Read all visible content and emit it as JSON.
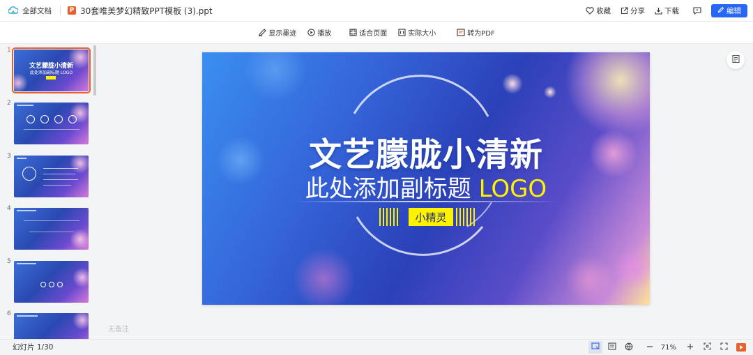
{
  "topbar": {
    "brand_label": "全部文档",
    "file_badge": "P",
    "filename": "30套唯美梦幻精致PPT模板 (3).ppt",
    "favorite_label": "收藏",
    "share_label": "分享",
    "download_label": "下载",
    "edit_label": "编辑"
  },
  "toolbar": {
    "show_ink_label": "显示墨迹",
    "play_label": "播放",
    "fit_page_label": "适合页面",
    "actual_size_label": "实际大小",
    "to_pdf_label": "转为PDF"
  },
  "sidebar": {
    "slides": [
      {
        "num": "1",
        "selected": true
      },
      {
        "num": "2"
      },
      {
        "num": "3"
      },
      {
        "num": "4"
      },
      {
        "num": "5"
      },
      {
        "num": "6"
      }
    ],
    "thumb1_title": "文艺朦胧小清新",
    "thumb1_sub": "此处添加副标题 LOGO"
  },
  "slide": {
    "title": "文艺朦胧小清新",
    "subtitle": "此处添加副标题",
    "logo": "LOGO",
    "tag": "小精灵"
  },
  "notes_placeholder": "无备注",
  "status": {
    "slide_counter": "幻灯片 1/30",
    "zoom": "71%"
  },
  "colors": {
    "accent": "#2867f5",
    "selected": "#e8612c",
    "highlight": "#fff200"
  }
}
